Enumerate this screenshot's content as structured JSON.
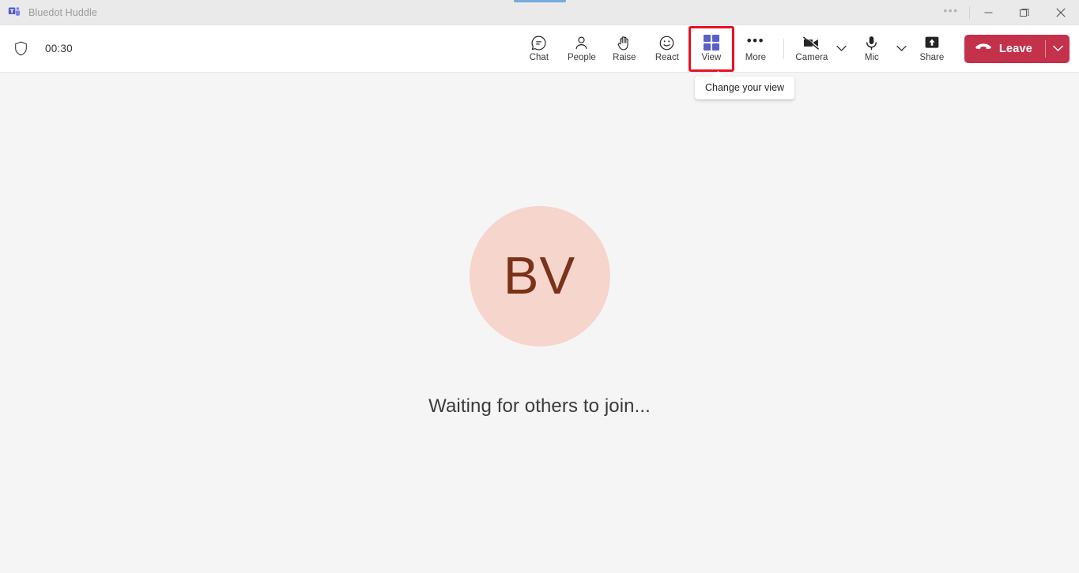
{
  "window": {
    "app_title": "Bluedot Huddle",
    "logo_icon": "teams-logo-icon",
    "controls": {
      "more_icon": "ellipsis-icon",
      "minimize_icon": "minimize-icon",
      "maximize_icon": "maximize-restore-icon",
      "close_icon": "close-icon"
    }
  },
  "toolbar": {
    "shield_icon": "shield-icon",
    "timer": "00:30",
    "items": [
      {
        "label": "Chat",
        "icon": "chat-bubble-icon"
      },
      {
        "label": "People",
        "icon": "people-icon"
      },
      {
        "label": "Raise",
        "icon": "raise-hand-icon"
      },
      {
        "label": "React",
        "icon": "smiley-react-icon"
      },
      {
        "label": "View",
        "icon": "grid-view-icon",
        "highlighted": true
      },
      {
        "label": "More",
        "icon": "ellipsis-icon"
      }
    ],
    "camera": {
      "label": "Camera",
      "icon": "camera-off-icon",
      "chevron_icon": "chevron-down-icon"
    },
    "mic": {
      "label": "Mic",
      "icon": "microphone-icon",
      "chevron_icon": "chevron-down-icon"
    },
    "share": {
      "label": "Share",
      "icon": "share-screen-icon"
    },
    "leave": {
      "label": "Leave",
      "icon": "hang-up-icon",
      "chevron_icon": "chevron-down-icon"
    }
  },
  "tooltip": {
    "text": "Change your view"
  },
  "stage": {
    "avatar_initials": "BV",
    "status_text": "Waiting for others to join..."
  },
  "colors": {
    "accent_purple": "#5b5fc7",
    "leave_red": "#c4314b",
    "highlight_red": "#e81123",
    "avatar_bg": "#f5d5cc",
    "avatar_fg": "#7b3218",
    "stage_bg": "#f5f5f5",
    "titlebar_bg": "#eaeaea",
    "drag_indicator_blue": "#77abdb"
  }
}
